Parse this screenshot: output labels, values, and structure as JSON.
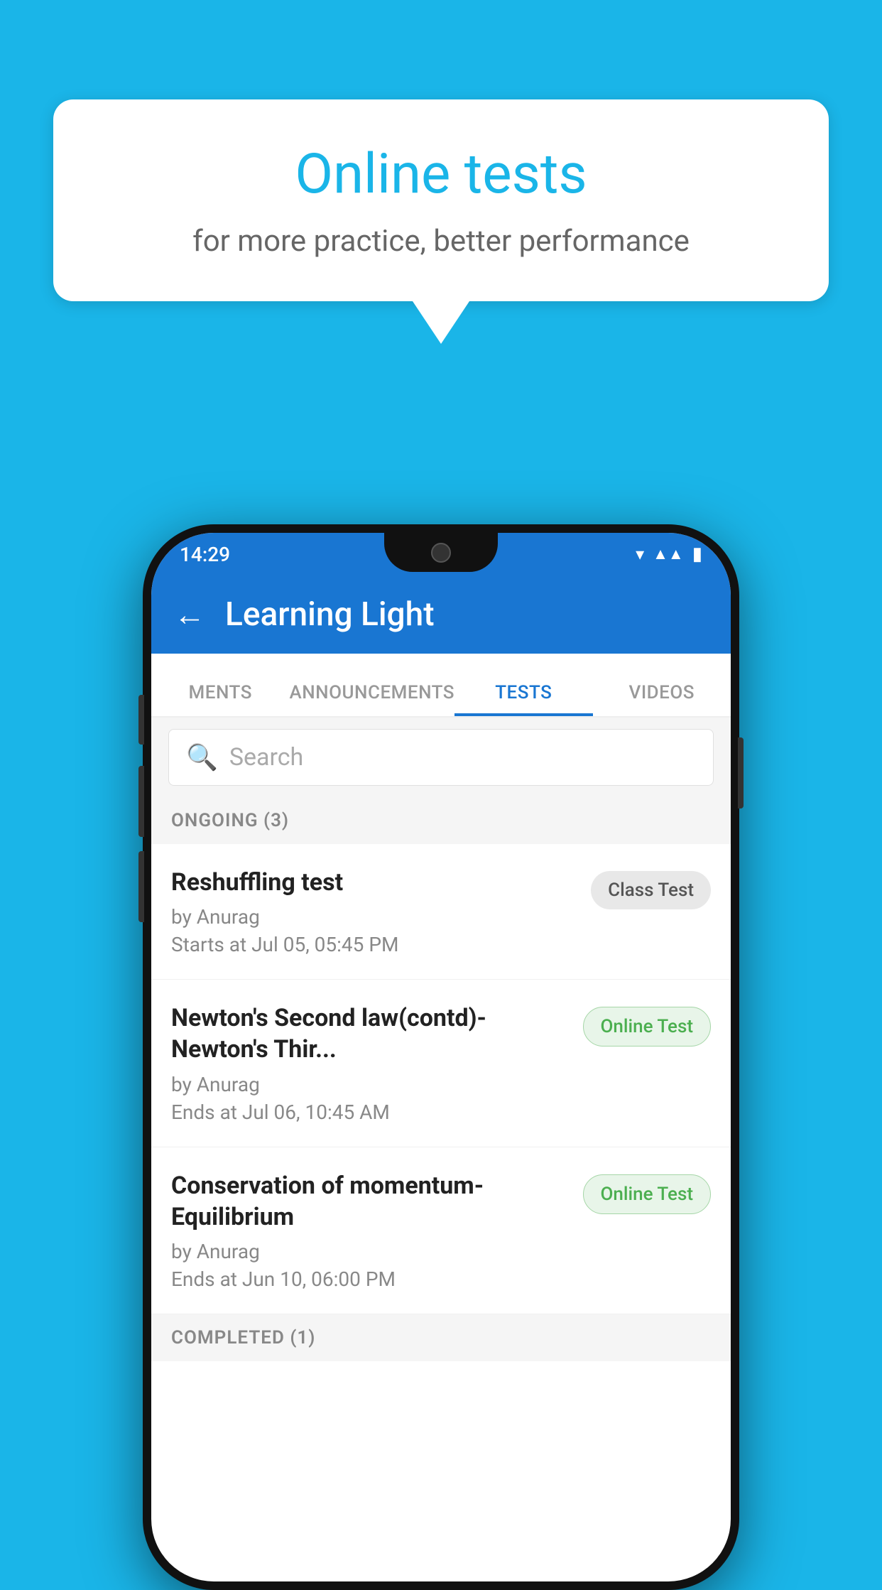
{
  "background_color": "#1ab5e8",
  "speech_bubble": {
    "title": "Online tests",
    "subtitle": "for more practice, better performance"
  },
  "phone": {
    "status_bar": {
      "time": "14:29",
      "icons": [
        "wifi",
        "signal",
        "battery"
      ]
    },
    "app_bar": {
      "title": "Learning Light",
      "back_label": "←"
    },
    "tabs": [
      {
        "label": "MENTS",
        "active": false
      },
      {
        "label": "ANNOUNCEMENTS",
        "active": false
      },
      {
        "label": "TESTS",
        "active": true
      },
      {
        "label": "VIDEOS",
        "active": false
      }
    ],
    "search": {
      "placeholder": "Search"
    },
    "ongoing_section": {
      "label": "ONGOING (3)"
    },
    "tests": [
      {
        "name": "Reshuffling test",
        "by": "by Anurag",
        "time_label": "Starts at",
        "time_value": "Jul 05, 05:45 PM",
        "badge": "Class Test",
        "badge_type": "class"
      },
      {
        "name": "Newton's Second law(contd)-Newton's Thir...",
        "by": "by Anurag",
        "time_label": "Ends at",
        "time_value": "Jul 06, 10:45 AM",
        "badge": "Online Test",
        "badge_type": "online"
      },
      {
        "name": "Conservation of momentum-Equilibrium",
        "by": "by Anurag",
        "time_label": "Ends at",
        "time_value": "Jun 10, 06:00 PM",
        "badge": "Online Test",
        "badge_type": "online"
      }
    ],
    "completed_section": {
      "label": "COMPLETED (1)"
    }
  }
}
